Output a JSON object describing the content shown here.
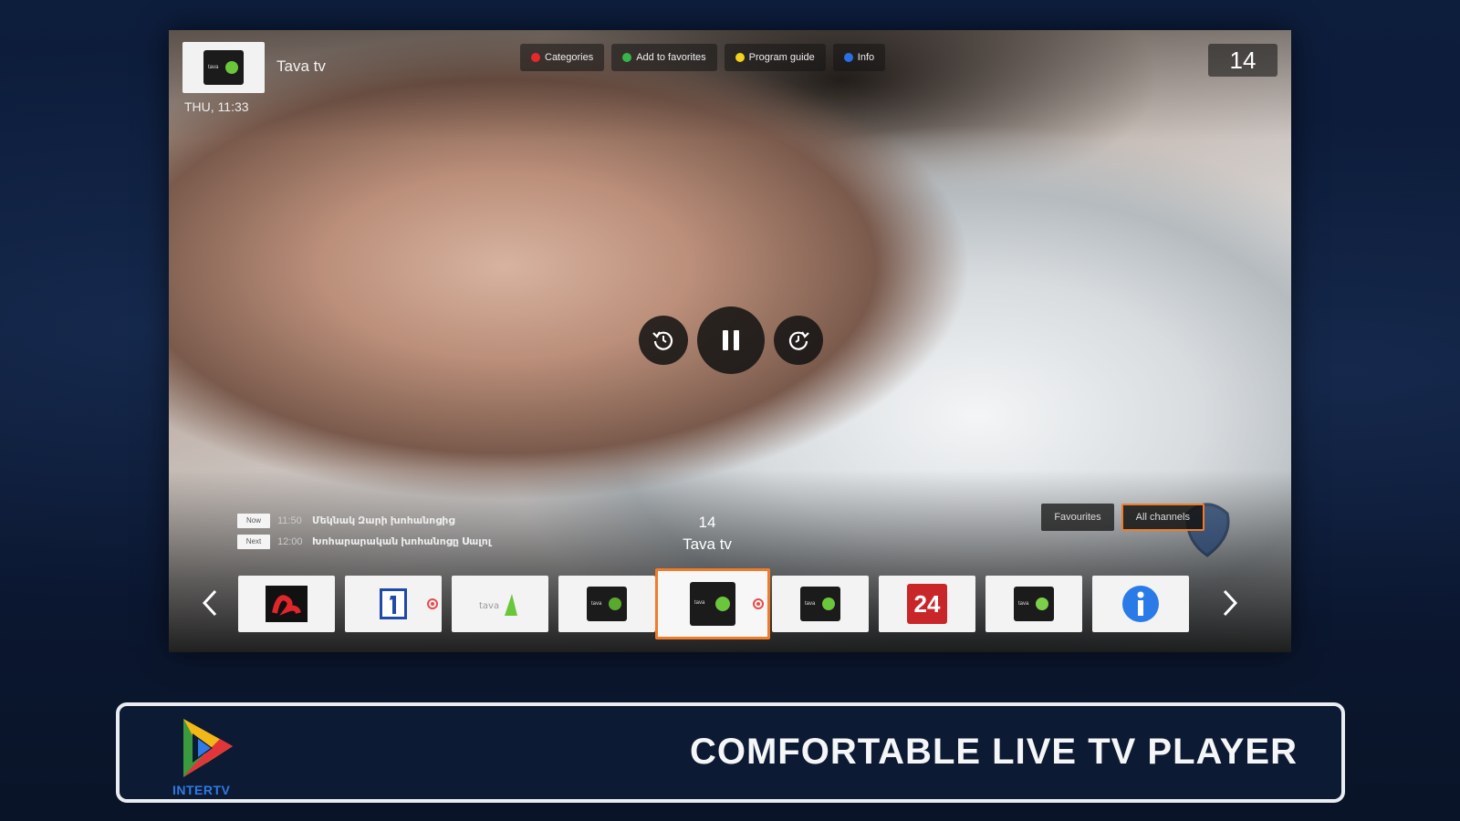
{
  "channel": {
    "name": "Tava tv",
    "time": "THU, 11:33",
    "number": "14"
  },
  "top_actions": [
    {
      "label": "Categories",
      "color": "#e8282b"
    },
    {
      "label": "Add to favorites",
      "color": "#38b54a"
    },
    {
      "label": "Program guide",
      "color": "#f4d11c"
    },
    {
      "label": "Info",
      "color": "#2a6fe3"
    }
  ],
  "playback": {
    "rewind_icon": "rewind-icon",
    "pause_icon": "pause-icon",
    "forward_icon": "forward-icon"
  },
  "program": {
    "now": {
      "badge": "Now",
      "time": "11:50",
      "title": "Մեկնակ Զարի խոհանոցից"
    },
    "next": {
      "badge": "Next",
      "time": "12:00",
      "title": "Խոհարարական խոհանոցը Սալոլ"
    }
  },
  "center_channel": {
    "number": "14",
    "name": "Tava tv"
  },
  "list_toggle": {
    "favourites": "Favourites",
    "all_channels": "All channels"
  },
  "carousel": [
    {
      "icon": "channel-logo-red",
      "favorite": false
    },
    {
      "icon": "channel-logo-1",
      "favorite": true
    },
    {
      "icon": "channel-logo-green",
      "favorite": false
    },
    {
      "icon": "channel-logo-dark",
      "favorite": false
    },
    {
      "icon": "channel-logo-tava",
      "favorite": true,
      "active": true
    },
    {
      "icon": "channel-logo-dark",
      "favorite": false
    },
    {
      "icon": "channel-logo-24",
      "favorite": false,
      "text": "24"
    },
    {
      "icon": "channel-logo-dark",
      "favorite": false
    },
    {
      "icon": "channel-logo-info",
      "favorite": false
    }
  ],
  "banner": {
    "app_name": "INTERTV",
    "tagline": "COMFORTABLE LIVE TV PLAYER"
  },
  "colors": {
    "accent": "#f07c2a",
    "brand_blue": "#2f7ae5"
  }
}
